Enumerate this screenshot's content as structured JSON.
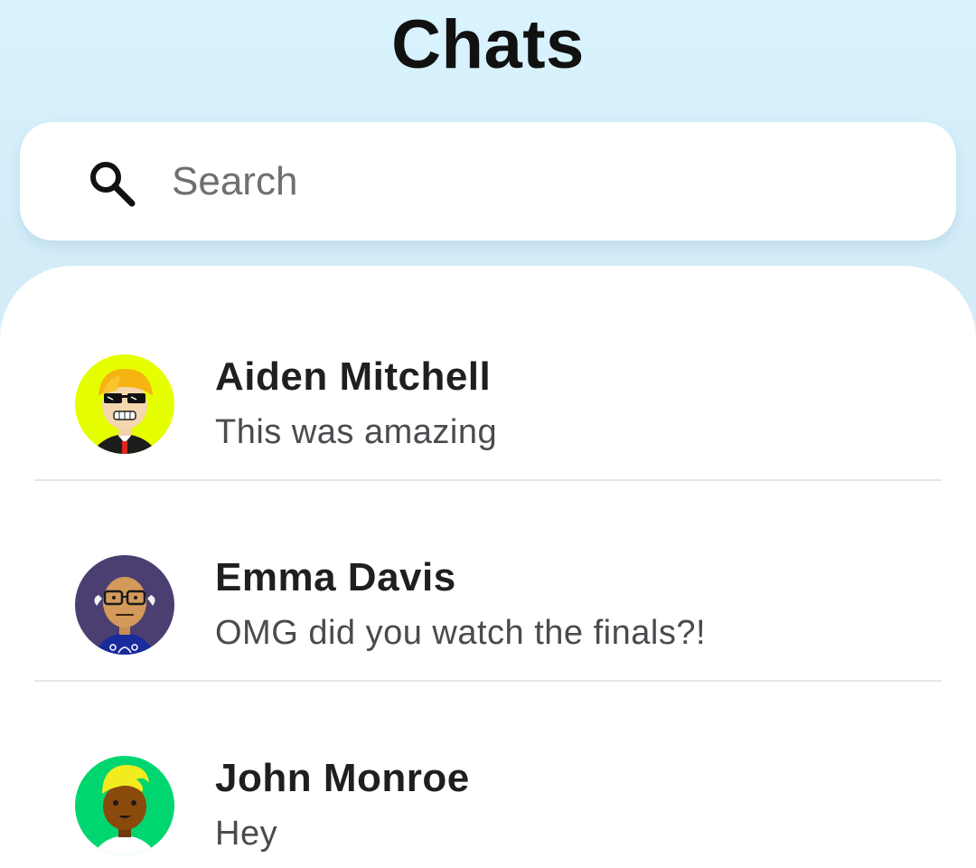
{
  "header": {
    "title": "Chats"
  },
  "search": {
    "placeholder": "Search",
    "icon": "search-icon"
  },
  "chats": [
    {
      "name": "Aiden Mitchell",
      "last_message": "This was amazing",
      "avatar_bg": "#e6ff00"
    },
    {
      "name": "Emma Davis",
      "last_message": "OMG did you watch the finals?!",
      "avatar_bg": "#4b3f72"
    },
    {
      "name": "John Monroe",
      "last_message": "Hey",
      "avatar_bg": "#00d66f"
    }
  ]
}
